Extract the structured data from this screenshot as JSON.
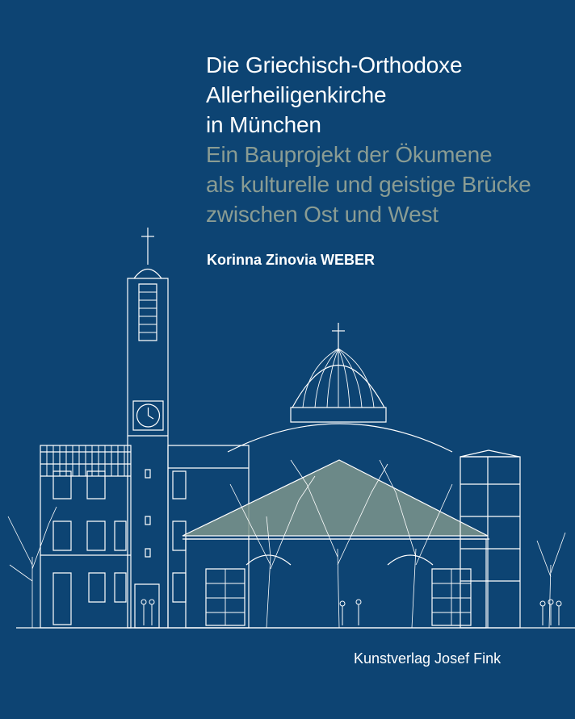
{
  "cover": {
    "title_lines": [
      "Die Griechisch-Orthodoxe",
      "Allerheiligenkirche",
      "in München"
    ],
    "subtitle_lines": [
      "Ein Bauprojekt der Ökumene",
      "als kulturelle und geistige Brücke",
      "zwischen Ost und West"
    ],
    "author": "Korinna Zinovia WEBER",
    "publisher": "Kunstverlag Josef Fink"
  },
  "colors": {
    "background": "#0d4473",
    "title": "#ffffff",
    "subtitle": "#8a9c93",
    "drawing_lines": "#ffffff",
    "roof_fill": "#7e958c"
  }
}
